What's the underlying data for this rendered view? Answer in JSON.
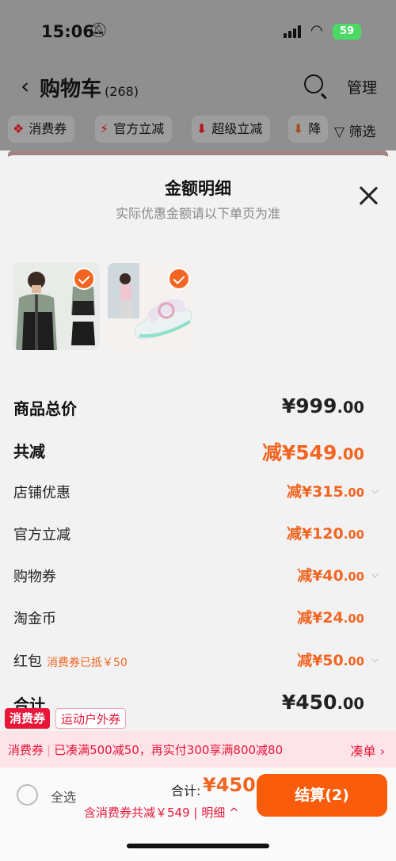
{
  "status_bar": {
    "time": "15:06",
    "battery": "59"
  },
  "background": {
    "title": "购物车",
    "count": "(268)",
    "manage": "管理",
    "chips": [
      {
        "icon": "voucher",
        "label": "消费券"
      },
      {
        "icon": "lightning",
        "label": "官方立减"
      },
      {
        "icon": "arrow-down",
        "label": "超级立减"
      },
      {
        "icon": "arrow-down",
        "label": "降"
      }
    ],
    "filter": "筛选"
  },
  "sheet": {
    "title": "金额明细",
    "subtitle": "实际优惠金额请以下单页为准",
    "products": [
      {
        "name": "jacket",
        "checked": true
      },
      {
        "name": "slipper",
        "checked": true
      }
    ],
    "rows": [
      {
        "label": "商品总价",
        "value": "¥999",
        "cents": ".00"
      },
      {
        "label": "共减",
        "value": "减¥549",
        "cents": ".00"
      },
      {
        "label": "店铺优惠",
        "value": "减¥315",
        "cents": ".00"
      },
      {
        "label": "官方立减",
        "value": "减¥120",
        "cents": ".00"
      },
      {
        "label": "购物券",
        "value": "减¥40",
        "cents": ".00"
      },
      {
        "label": "淘金币",
        "value": "减¥24",
        "cents": ".00"
      },
      {
        "label": "红包",
        "note": "消费券已抵￥50",
        "value": "减¥50",
        "cents": ".00"
      },
      {
        "label": "合计",
        "value": "¥450",
        "cents": ".00"
      }
    ]
  },
  "tags": {
    "primary": "消费券",
    "secondary": "运动户外券"
  },
  "promo": {
    "prefix": "消费券",
    "text": "已凑满500减50，再实付300享满800减80",
    "link": "凑单 ›"
  },
  "footer": {
    "select_all": "全选",
    "total_label": "合计:",
    "total_value": "¥450",
    "sub": "含消费券共减￥549 | 明细 ^",
    "checkout": "结算(2)"
  }
}
